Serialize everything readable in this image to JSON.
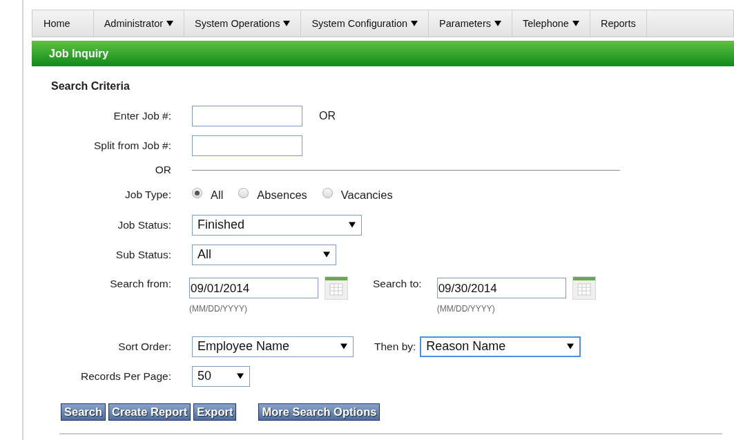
{
  "menu": [
    {
      "label": "Home",
      "has_menu": false
    },
    {
      "label": "Administrator",
      "has_menu": true
    },
    {
      "label": "System Operations",
      "has_menu": true
    },
    {
      "label": "System Configuration",
      "has_menu": true
    },
    {
      "label": "Parameters",
      "has_menu": true
    },
    {
      "label": "Telephone",
      "has_menu": true
    },
    {
      "label": "Reports",
      "has_menu": false
    }
  ],
  "header": {
    "title": "Job Inquiry"
  },
  "search_criteria": {
    "title": "Search Criteria",
    "job_number": {
      "label": "Enter Job #:",
      "or": "OR"
    },
    "split_from": {
      "label": "Split from Job #:"
    },
    "divider_or": "OR",
    "job_type": {
      "label": "Job Type:",
      "options": [
        {
          "label": "All",
          "selected": true
        },
        {
          "label": "Absences",
          "selected": false
        },
        {
          "label": "Vacancies",
          "selected": false
        }
      ]
    },
    "job_status": {
      "label": "Job Status:",
      "value": "Finished"
    },
    "sub_status": {
      "label": "Sub Status:",
      "value": "All"
    },
    "search_from": {
      "label": "Search from:",
      "value": "09/01/2014",
      "hint": "(MM/DD/YYYY)"
    },
    "search_to": {
      "label": "Search to:",
      "value": "09/30/2014",
      "hint": "(MM/DD/YYYY)"
    },
    "sort_order": {
      "label": "Sort Order:",
      "value": "Employee Name",
      "focused": false
    },
    "then_by": {
      "label": "Then by:",
      "value": "Reason Name",
      "focused": true
    },
    "records_per_page": {
      "label": "Records Per Page:",
      "value": "50"
    }
  },
  "buttons": [
    "Search",
    "Create Report",
    "Export"
  ],
  "options_button": "More Search Options"
}
